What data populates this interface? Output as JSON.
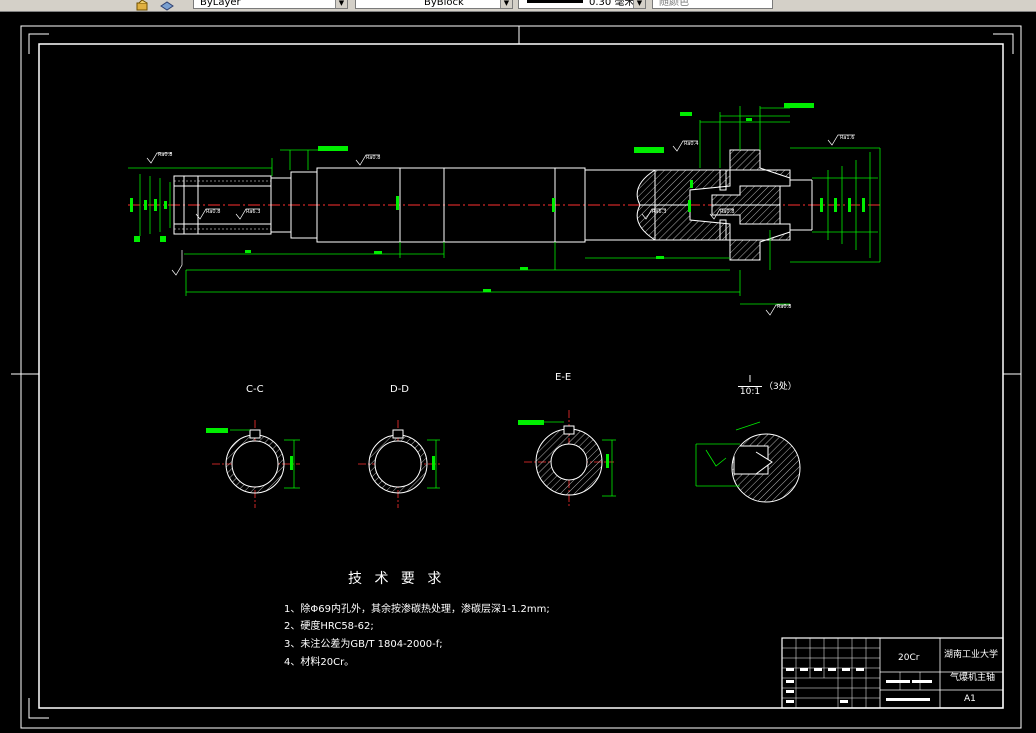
{
  "toolbar": {
    "layer_select": "ByLayer",
    "linetype_select": "ByBlock",
    "lineweight_select": "0.30 毫米",
    "plotstyle_select": "随颜色"
  },
  "drawing": {
    "sections": {
      "cc": "C-C",
      "dd": "D-D",
      "ee": "E-E",
      "detail_id": "I",
      "detail_scale": "10:1",
      "detail_count": "（3处）"
    },
    "tech_requirements": {
      "title": "技 术 要 求",
      "items": [
        "1、除Φ69内孔外，其余按渗碳热处理，渗碳层深1-1.2mm;",
        "2、硬度HRC58-62;",
        "3、未注公差为GB/T 1804-2000-f;",
        "4、材料20Cr。"
      ]
    },
    "title_block": {
      "material": "20Cr",
      "company": "湖南工业大学",
      "part_name": "气爆机主轴",
      "sheet_size": "A1"
    },
    "colors": {
      "background": "#000000",
      "frame": "#ffffff",
      "dimension": "#00ff00",
      "centerline": "#ff0000"
    }
  }
}
